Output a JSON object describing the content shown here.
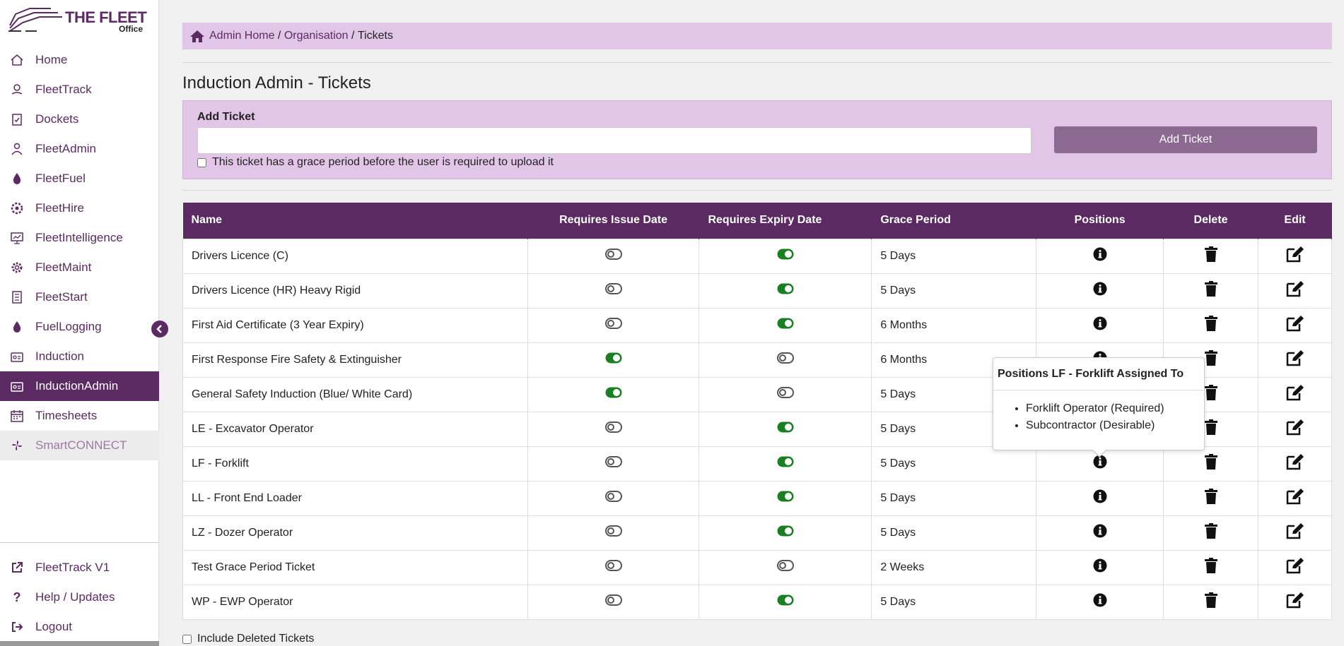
{
  "app": {
    "logo_title": "THE FLEET",
    "logo_subtitle": "Office"
  },
  "colors": {
    "brand": "#5c2a63",
    "header_bg": "#e2c6e8",
    "toggle_on": "#1a7f23",
    "toggle_off": "#555555"
  },
  "sidebar": {
    "items": [
      {
        "label": "Home",
        "icon": "home-icon"
      },
      {
        "label": "FleetTrack",
        "icon": "map-pin-icon"
      },
      {
        "label": "Dockets",
        "icon": "clipboard-check-icon"
      },
      {
        "label": "FleetAdmin",
        "icon": "user-admin-icon"
      },
      {
        "label": "FleetFuel",
        "icon": "fuel-drop-icon"
      },
      {
        "label": "FleetHire",
        "icon": "hire-cog-icon"
      },
      {
        "label": "FleetIntelligence",
        "icon": "monitor-chart-icon"
      },
      {
        "label": "FleetMaint",
        "icon": "gear-icon"
      },
      {
        "label": "FleetStart",
        "icon": "checklist-icon"
      },
      {
        "label": "FuelLogging",
        "icon": "fuel-drop-icon"
      },
      {
        "label": "Induction",
        "icon": "id-card-icon"
      },
      {
        "label": "InductionAdmin",
        "icon": "id-card-icon"
      },
      {
        "label": "Timesheets",
        "icon": "calendar-icon"
      },
      {
        "label": "SmartCONNECT",
        "icon": "smartconnect-icon"
      }
    ],
    "bottom_items": [
      {
        "label": "FleetTrack V1",
        "icon": "external-link-icon"
      },
      {
        "label": "Help / Updates",
        "icon": "question-icon"
      },
      {
        "label": "Logout",
        "icon": "logout-icon"
      }
    ]
  },
  "breadcrumb": {
    "home": "Admin Home",
    "sep1": " / ",
    "org": "Organisation",
    "sep2": " / ",
    "current": "Tickets"
  },
  "page": {
    "title": "Induction Admin - Tickets"
  },
  "add_ticket": {
    "label": "Add Ticket",
    "input_value": "",
    "grace_checkbox_label": "This ticket has a grace period before the user is required to upload it",
    "button_label": "Add Ticket"
  },
  "table": {
    "headers": {
      "name": "Name",
      "issue": "Requires Issue Date",
      "expiry": "Requires Expiry Date",
      "grace": "Grace Period",
      "positions": "Positions",
      "delete": "Delete",
      "edit": "Edit"
    },
    "rows": [
      {
        "name": "Drivers Licence (C)",
        "issue": false,
        "expiry": true,
        "grace": "5 Days"
      },
      {
        "name": "Drivers Licence (HR) Heavy Rigid",
        "issue": false,
        "expiry": true,
        "grace": "5 Days"
      },
      {
        "name": "First Aid Certificate (3 Year Expiry)",
        "issue": false,
        "expiry": true,
        "grace": "6 Months"
      },
      {
        "name": "First Response Fire Safety & Extinguisher",
        "issue": true,
        "expiry": false,
        "grace": "6 Months"
      },
      {
        "name": "General Safety Induction (Blue/ White Card)",
        "issue": true,
        "expiry": false,
        "grace": "5 Days"
      },
      {
        "name": "LE - Excavator Operator",
        "issue": false,
        "expiry": true,
        "grace": "5 Days"
      },
      {
        "name": "LF - Forklift",
        "issue": false,
        "expiry": true,
        "grace": "5 Days"
      },
      {
        "name": "LL - Front End Loader",
        "issue": false,
        "expiry": true,
        "grace": "5 Days"
      },
      {
        "name": "LZ - Dozer Operator",
        "issue": false,
        "expiry": true,
        "grace": "5 Days"
      },
      {
        "name": "Test Grace Period Ticket",
        "issue": false,
        "expiry": false,
        "grace": "2 Weeks"
      },
      {
        "name": "WP - EWP Operator",
        "issue": false,
        "expiry": true,
        "grace": "5 Days"
      }
    ]
  },
  "popover": {
    "title": "Positions LF - Forklift Assigned To",
    "items": [
      "Forklift Operator (Required)",
      "Subcontractor (Desirable)"
    ]
  },
  "footer": {
    "include_deleted_label": "Include Deleted Tickets"
  }
}
